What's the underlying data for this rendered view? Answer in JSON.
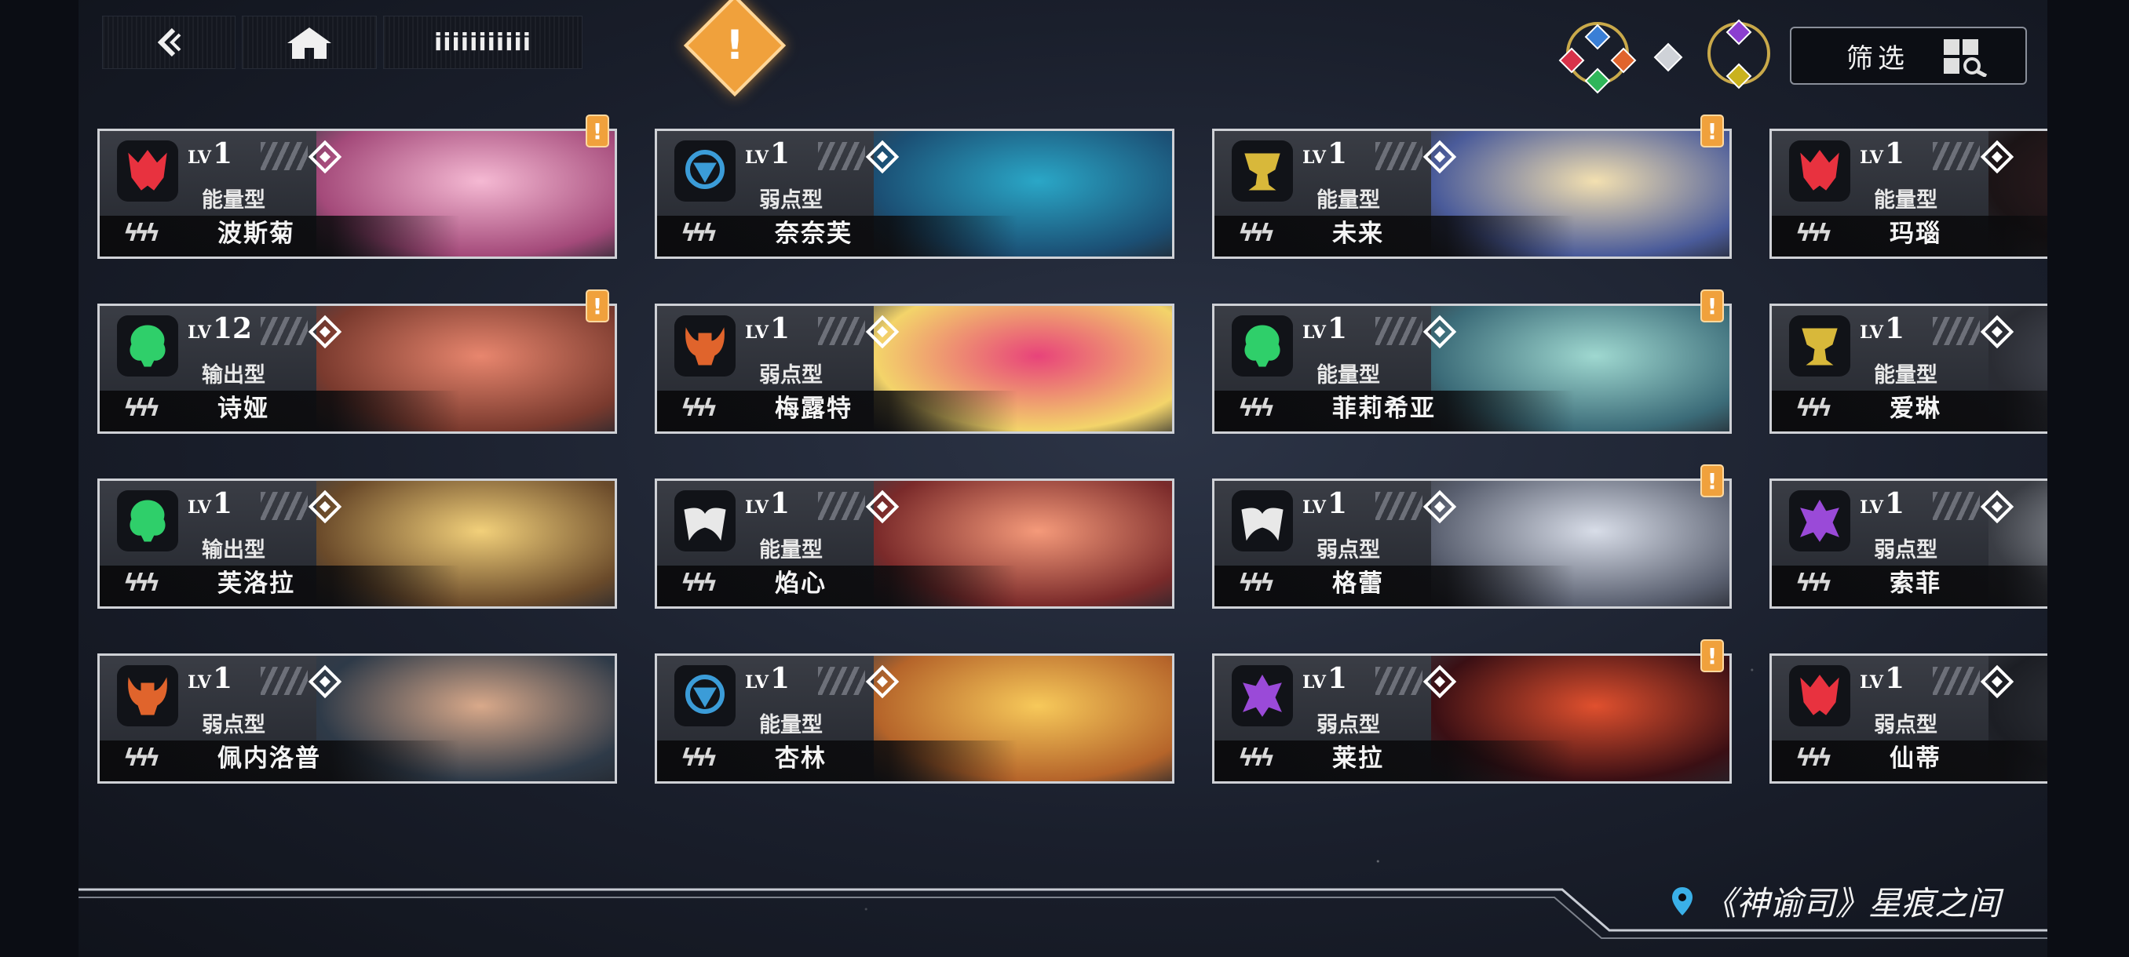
{
  "header": {
    "title": "iiiiiiiiiii",
    "filter_label": "筛选",
    "alert_mark": "!"
  },
  "elements": [
    {
      "icon": "blue-gem",
      "color": "#3a7fd6"
    },
    {
      "icon": "red-gem",
      "color": "#d8324a"
    },
    {
      "icon": "orange-gem",
      "color": "#e0642c"
    },
    {
      "icon": "green-gem",
      "color": "#2fb65a"
    },
    {
      "icon": "white-gem",
      "color": "#d8d8d8"
    },
    {
      "icon": "purple-gem",
      "color": "#8b3fd0"
    },
    {
      "icon": "yellow-gem",
      "color": "#c9b21e"
    }
  ],
  "cards": [
    {
      "name": "波斯菊",
      "type": "能量型",
      "lv": "1",
      "element": "fire",
      "alert": "!",
      "palette": [
        "#f5b9d3",
        "#a44a7a"
      ]
    },
    {
      "name": "奈奈芙",
      "type": "弱点型",
      "lv": "1",
      "element": "water",
      "alert": "",
      "palette": [
        "#2aa7c7",
        "#1b4f74"
      ]
    },
    {
      "name": "未来",
      "type": "能量型",
      "lv": "1",
      "element": "gold",
      "alert": "!",
      "palette": [
        "#f3e0b0",
        "#4a5b9a"
      ]
    },
    {
      "name": "玛瑙",
      "type": "能量型",
      "lv": "1",
      "element": "fire",
      "alert": "",
      "palette": [
        "#3a2024",
        "#1b1416"
      ]
    },
    {
      "name": "诗娅",
      "type": "输出型",
      "lv": "12",
      "element": "wood",
      "alert": "!",
      "palette": [
        "#e8866e",
        "#7a3a2e"
      ]
    },
    {
      "name": "梅露特",
      "type": "弱点型",
      "lv": "1",
      "element": "beast",
      "alert": "",
      "palette": [
        "#e8437a",
        "#f3d46a"
      ]
    },
    {
      "name": "菲莉希亚",
      "type": "能量型",
      "lv": "1",
      "element": "wood",
      "alert": "!",
      "palette": [
        "#9fd8d0",
        "#3b6b78"
      ]
    },
    {
      "name": "爱琳",
      "type": "能量型",
      "lv": "1",
      "element": "gold",
      "alert": "",
      "palette": [
        "#5a5e6a",
        "#2a2c33"
      ]
    },
    {
      "name": "芙洛拉",
      "type": "输出型",
      "lv": "1",
      "element": "wood",
      "alert": "",
      "palette": [
        "#f2d07a",
        "#6a4a2a"
      ]
    },
    {
      "name": "焰心",
      "type": "能量型",
      "lv": "1",
      "element": "wing",
      "alert": "",
      "palette": [
        "#f59a7a",
        "#7a2a2a"
      ]
    },
    {
      "name": "格蕾",
      "type": "弱点型",
      "lv": "1",
      "element": "wing",
      "alert": "!",
      "palette": [
        "#d8dde8",
        "#5a6070"
      ]
    },
    {
      "name": "索菲",
      "type": "弱点型",
      "lv": "1",
      "element": "void",
      "alert": "",
      "palette": [
        "#c0c4cc",
        "#3a3d44"
      ]
    },
    {
      "name": "佩内洛普",
      "type": "弱点型",
      "lv": "1",
      "element": "beast",
      "alert": "",
      "palette": [
        "#d9a98a",
        "#2e3a48"
      ]
    },
    {
      "name": "杏林",
      "type": "能量型",
      "lv": "1",
      "element": "water",
      "alert": "",
      "palette": [
        "#f7c95a",
        "#b5642a"
      ]
    },
    {
      "name": "莱拉",
      "type": "弱点型",
      "lv": "1",
      "element": "void",
      "alert": "!",
      "palette": [
        "#e0502e",
        "#3a0f14"
      ]
    },
    {
      "name": "仙蒂",
      "type": "弱点型",
      "lv": "1",
      "element": "fire",
      "alert": "",
      "palette": [
        "#3a3d44",
        "#1c1e24"
      ]
    }
  ],
  "lv_prefix": "LV",
  "footer": {
    "location": "《神谕司》星痕之间"
  },
  "colors": {
    "fire": "#e8323f",
    "water": "#3b9cd8",
    "gold": "#d8b83a",
    "wood": "#2fcf6a",
    "beast": "#e0642c",
    "wing": "#e8e8e8",
    "void": "#9a4ad8",
    "accent": "#f0a13c"
  }
}
